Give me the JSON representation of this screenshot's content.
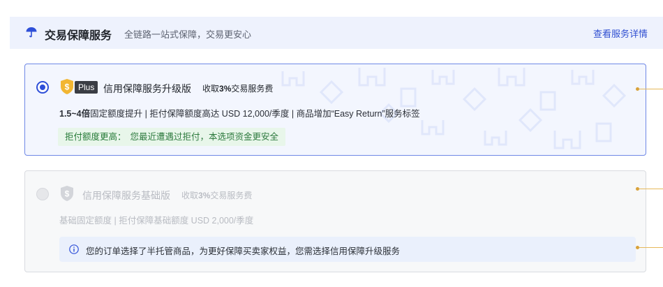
{
  "header": {
    "title": "交易保障服务",
    "subtitle": "全链路一站式保障，交易更安心",
    "link": "查看服务详情",
    "icon": "umbrella-icon"
  },
  "plans": [
    {
      "selected": true,
      "badge": "Plus",
      "title": "信用保障服务升级版",
      "fee_prefix": "收取",
      "fee_value": "3%",
      "fee_suffix": "交易服务费",
      "desc_bold": "1.5~4倍",
      "desc_rest": "固定额度提升 | 拒付保障额度高达 USD 12,000/季度 | 商品增加“Easy Return”服务标签",
      "tip_label": "拒付额度更高：",
      "tip_text": "您最近遭遇过拒付，本选项资金更安全"
    },
    {
      "selected": false,
      "title": "信用保障服务基础版",
      "fee_prefix": "收取",
      "fee_value": "3%",
      "fee_suffix": "交易服务费",
      "desc": "基础固定额度 | 拒付保障基础额度 USD 2,000/季度",
      "info_text": "您的订单选择了半托管商品，为更好保障买卖家权益，您需选择信用保障升级服务"
    }
  ],
  "colors": {
    "accent": "#2e4fd8",
    "header_bg": "#eef2fd",
    "selected_border": "#6f88e6",
    "tip_bg": "#e8f6ea",
    "connector": "#e6b85a"
  }
}
